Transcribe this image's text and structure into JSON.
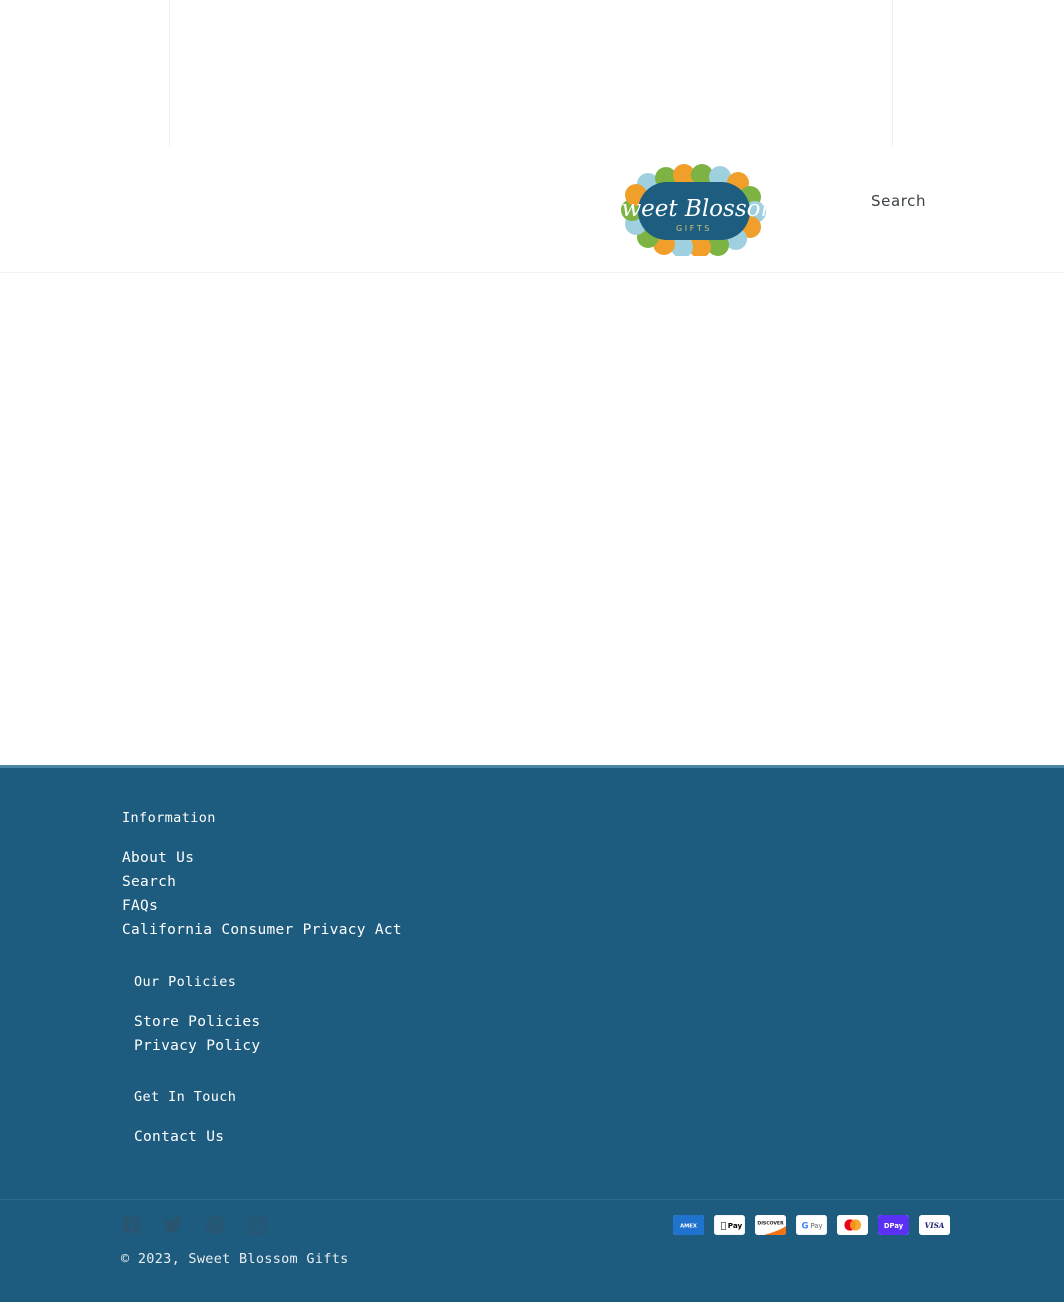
{
  "header": {
    "logo_alt": "Sweet Blossom Gifts",
    "logo_name": "Sweet Blossom",
    "logo_sub": "GIFTS",
    "search_label": "Search"
  },
  "footer": {
    "blocks": [
      {
        "heading": "Information",
        "links": [
          "About Us",
          "Search",
          "FAQs",
          "California Consumer Privacy Act"
        ]
      },
      {
        "heading": "Our Policies",
        "links": [
          "Store Policies",
          "Privacy Policy"
        ]
      },
      {
        "heading": "Get In Touch",
        "links": [
          "Contact Us"
        ]
      }
    ],
    "social": [
      {
        "name": "facebook-icon",
        "label": "Facebook"
      },
      {
        "name": "twitter-icon",
        "label": "Twitter"
      },
      {
        "name": "pinterest-icon",
        "label": "Pinterest"
      },
      {
        "name": "instagram-icon",
        "label": "Instagram"
      }
    ],
    "copyright": "© 2023, Sweet Blossom Gifts",
    "payments": [
      {
        "name": "american-express-icon",
        "label": "American Express"
      },
      {
        "name": "apple-pay-icon",
        "label": "Apple Pay"
      },
      {
        "name": "discover-icon",
        "label": "Discover"
      },
      {
        "name": "google-pay-icon",
        "label": "Google Pay"
      },
      {
        "name": "mastercard-icon",
        "label": "Mastercard"
      },
      {
        "name": "shop-pay-icon",
        "label": "Shop Pay"
      },
      {
        "name": "visa-icon",
        "label": "Visa"
      }
    ]
  },
  "colors": {
    "footer_bg": "#1e5c7f",
    "footer_border": "#4b86a4",
    "logo_blue": "#1d5d80",
    "logo_green": "#7cb342",
    "logo_orange": "#f0a02a",
    "logo_lightblue": "#9fd0e0",
    "social_icon": "#2a5570",
    "text_light": "#ffffff"
  }
}
